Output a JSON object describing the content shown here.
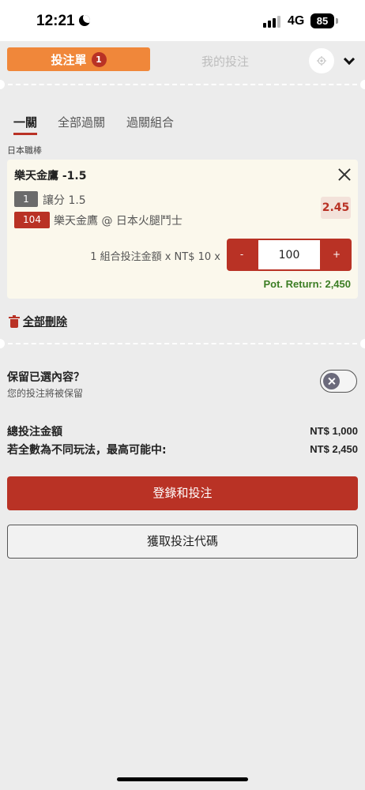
{
  "status_bar": {
    "time": "12:21",
    "network": "4G",
    "battery": "85"
  },
  "header": {
    "bet_slip_tab": "投注單",
    "bet_slip_count": "1",
    "my_bets_tab": "我的投注"
  },
  "bet_type_tabs": [
    "一關",
    "全部過關",
    "過關組合"
  ],
  "selection": {
    "league": "日本職棒",
    "title": "樂天金鷹 -1.5",
    "market_badge": "1",
    "market": "讓分 1.5",
    "match_badge": "104",
    "match": "樂天金鷹 @ 日本火腿鬥士",
    "odds": "2.45",
    "stake_label": "1 組合投注金額 x NT$ 10 x",
    "minus": "-",
    "stake_value": "100",
    "plus": "+",
    "pot_return": "Pot. Return: 2,450"
  },
  "delete_all": "全部刪除",
  "keep_selections": {
    "title": "保留已選內容？",
    "subtitle": "您的投注將被保留"
  },
  "totals": {
    "total_stake_label": "總投注金額",
    "total_stake_value": "NT$ 1,000",
    "max_win_label": "若全數為不同玩法，最高可能中:",
    "max_win_value": "NT$ 2,450"
  },
  "buttons": {
    "login_and_bet": "登錄和投注",
    "get_bet_code": "獲取投注代碼"
  },
  "colors": {
    "accent_orange": "#f0873a",
    "accent_red": "#b93225",
    "pot_return_green": "#3b7d23"
  }
}
